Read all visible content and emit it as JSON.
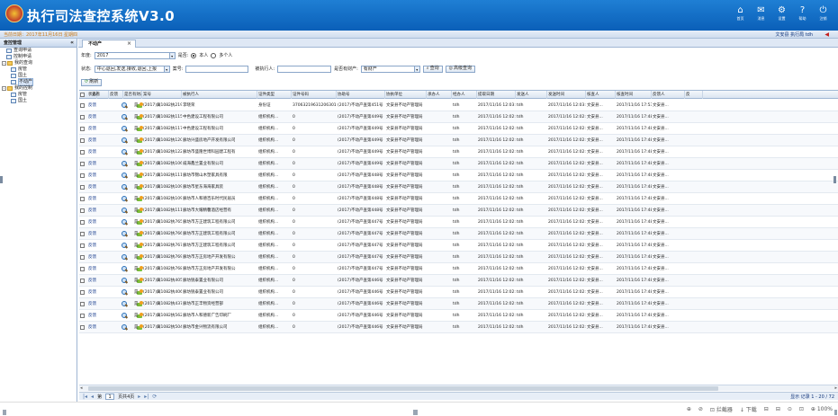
{
  "header": {
    "title": "执行司法查控系统V3.0",
    "toolbar": [
      {
        "icon": "home-icon",
        "glyph": "⌂",
        "label": "首页"
      },
      {
        "icon": "mail-icon",
        "glyph": "✉",
        "label": "消息"
      },
      {
        "icon": "gear-icon",
        "glyph": "⚙",
        "label": "设置"
      },
      {
        "icon": "help-icon",
        "glyph": "?",
        "label": "帮助"
      },
      {
        "icon": "power-icon",
        "glyph": "⏻",
        "label": "注销"
      }
    ]
  },
  "statusbar": {
    "date": "当前日期：2017年11月16日  星期四",
    "user": "文安县 执行局  tdh"
  },
  "sidebar": {
    "title": "查控管理",
    "items": [
      {
        "label": "查询申请",
        "level": 1,
        "type": "page"
      },
      {
        "label": "控制申请",
        "level": 1,
        "type": "page"
      },
      {
        "label": "我的查询",
        "level": 0,
        "type": "folder",
        "expander": "-"
      },
      {
        "label": "房管",
        "level": 2,
        "type": "page"
      },
      {
        "label": "国土",
        "level": 2,
        "type": "page"
      },
      {
        "label": "不动产",
        "level": 2,
        "type": "page",
        "selected": true
      },
      {
        "label": "我的控制",
        "level": 0,
        "type": "folder",
        "expander": "-"
      },
      {
        "label": "房管",
        "level": 2,
        "type": "page"
      },
      {
        "label": "国土",
        "level": 2,
        "type": "page"
      }
    ]
  },
  "tab": {
    "label": "不动产",
    "close": "×"
  },
  "filters": {
    "year_label": "年度:",
    "year_value": "2017",
    "is_self_label": "是否:",
    "radio_self": "本人",
    "radio_multi": "多个人",
    "status_label": "状态:",
    "status_value": "中心退回,发送,接收,退回,上报",
    "case_no_label": "案号:",
    "executed_label": "被执行人:",
    "has_property_label": "是否有财产:",
    "has_property_value": "有财产",
    "search_btn": "查询",
    "advanced_btn": "高级查询",
    "refresh_btn": "刷新"
  },
  "table": {
    "columns": [
      "状态",
      "查看",
      "反馈",
      "是否有财产",
      "案号",
      "被执行人",
      "证件类型",
      "证件号码",
      "协助号",
      "协执单位",
      "承办人",
      "经办人",
      "提取日期",
      "发送人",
      "发送时间",
      "核查人",
      "核查时间",
      "反馈人",
      "反"
    ],
    "rows": [
      {
        "status": "反馈",
        "has": "是",
        "case": "(2017)冀1082执2193号",
        "person": "李晓荣",
        "idtype": "身份证",
        "idno": "370632196312063019",
        "assist": "(2017)不动产查第451号",
        "unit": "文安县不动产管理局",
        "handler": "tdh",
        "extract": "2017/11/16 12:03:04",
        "sender": "tdh",
        "send_time": "2017/11/16 12:03:11",
        "checker": "文安县...",
        "check_time": "2017/11/16 17:53:41",
        "feedback": "文安县..."
      },
      {
        "status": "反馈",
        "has": "是",
        "case": "(2017)冀1082执1157号",
        "person": "中色建设工程有限公司",
        "idtype": "组织机构...",
        "idno": "0",
        "assist": "(2017)不动产查第449号",
        "unit": "文安县不动产管理局",
        "handler": "tdh",
        "extract": "2017/11/16 12:02:46",
        "sender": "tdh",
        "send_time": "2017/11/16 12:02:54",
        "checker": "文安县...",
        "check_time": "2017/11/16 17:48:07",
        "feedback": "文安县..."
      },
      {
        "status": "反馈",
        "has": "是",
        "case": "(2017)冀1082执1177号",
        "person": "中色建设工程有限公司",
        "idtype": "组织机构...",
        "idno": "0",
        "assist": "(2017)不动产查第449号",
        "unit": "文安县不动产管理局",
        "handler": "tdh",
        "extract": "2017/11/16 12:02:46",
        "sender": "tdh",
        "send_time": "2017/11/16 12:02:54",
        "checker": "文安县...",
        "check_time": "2017/11/16 17:48:07",
        "feedback": "文安县..."
      },
      {
        "status": "反馈",
        "has": "是",
        "case": "(2017)冀1082执1204号",
        "person": "廊坊兴盛房地产开发有限公司",
        "idtype": "组织机构...",
        "idno": "0",
        "assist": "(2017)不动产查第449号",
        "unit": "文安县不动产管理局",
        "handler": "tdh",
        "extract": "2017/11/16 12:02:46",
        "sender": "tdh",
        "send_time": "2017/11/16 12:02:54",
        "checker": "文安县...",
        "check_time": "2017/11/16 17:48:07",
        "feedback": "文安县..."
      },
      {
        "status": "反馈",
        "has": "是",
        "case": "(2017)冀1082执1221号",
        "person": "廊坊市盛隆世博科园建工程有",
        "idtype": "组织机构...",
        "idno": "0",
        "assist": "(2017)不动产查第449号",
        "unit": "文安县不动产管理局",
        "handler": "tdh",
        "extract": "2017/11/16 12:02:46",
        "sender": "tdh",
        "send_time": "2017/11/16 12:02:54",
        "checker": "文安县...",
        "check_time": "2017/11/16 17:48:07",
        "feedback": "文安县..."
      },
      {
        "status": "反馈",
        "has": "是",
        "case": "(2017)冀1082执1063号",
        "person": "威海鑫兰置业有限公司",
        "idtype": "组织机构...",
        "idno": "0",
        "assist": "(2017)不动产查第449号",
        "unit": "文安县不动产管理局",
        "handler": "tdh",
        "extract": "2017/11/16 12:02:46",
        "sender": "tdh",
        "send_time": "2017/11/16 12:02:54",
        "checker": "文安县...",
        "check_time": "2017/11/16 17:48:07",
        "feedback": "文安县..."
      },
      {
        "status": "反馈",
        "has": "是",
        "case": "(2017)冀1082执1117号",
        "person": "廊坊市锦山木塑家具有限",
        "idtype": "组织机构...",
        "idno": "0",
        "assist": "(2017)不动产查第448号",
        "unit": "文安县不动产管理局",
        "handler": "tdh",
        "extract": "2017/11/16 12:02:34",
        "sender": "tdh",
        "send_time": "2017/11/16 12:02:45",
        "checker": "文安县...",
        "check_time": "2017/11/16 17:48:07",
        "feedback": "文安县..."
      },
      {
        "status": "反馈",
        "has": "是",
        "case": "(2017)冀1082执1094号",
        "person": "廊坊市星东海海家具装",
        "idtype": "组织机构...",
        "idno": "0",
        "assist": "(2017)不动产查第448号",
        "unit": "文安县不动产管理局",
        "handler": "tdh",
        "extract": "2017/11/16 12:02:34",
        "sender": "tdh",
        "send_time": "2017/11/16 12:02:45",
        "checker": "文安县...",
        "check_time": "2017/11/16 17:48:07",
        "feedback": "文安县..."
      },
      {
        "status": "反馈",
        "has": "是",
        "case": "(2017)冀1082执1090号",
        "person": "廊坊市人和德百乐时代民居员",
        "idtype": "组织机构...",
        "idno": "0",
        "assist": "(2017)不动产查第448号",
        "unit": "文安县不动产管理局",
        "handler": "tdh",
        "extract": "2017/11/16 12:02:34",
        "sender": "tdh",
        "send_time": "2017/11/16 12:02:45",
        "checker": "文安县...",
        "check_time": "2017/11/16 17:48:07",
        "feedback": "文安县..."
      },
      {
        "status": "反馈",
        "has": "是",
        "case": "(2017)冀1082执1111号",
        "person": "廊坊市大耀精馨酒店经营有",
        "idtype": "组织机构...",
        "idno": "0",
        "assist": "(2017)不动产查第448号",
        "unit": "文安县不动产管理局",
        "handler": "tdh",
        "extract": "2017/11/16 12:02:34",
        "sender": "tdh",
        "send_time": "2017/11/16 12:02:45",
        "checker": "文安县...",
        "check_time": "2017/11/16 17:48:07",
        "feedback": "文安县..."
      },
      {
        "status": "反馈",
        "has": "是",
        "case": "(2017)冀1082执765号",
        "person": "廊坊市方正建筑工程有限公司",
        "idtype": "组织机构...",
        "idno": "0",
        "assist": "(2017)不动产查第447号",
        "unit": "文安县不动产管理局",
        "handler": "tdh",
        "extract": "2017/11/16 12:02:23",
        "sender": "tdh",
        "send_time": "2017/11/16 12:02:33",
        "checker": "文安县...",
        "check_time": "2017/11/16 17:48:07",
        "feedback": "文安县..."
      },
      {
        "status": "反馈",
        "has": "是",
        "case": "(2017)冀1082执766号",
        "person": "廊坊市方正建筑工程有限公司",
        "idtype": "组织机构...",
        "idno": "0",
        "assist": "(2017)不动产查第447号",
        "unit": "文安县不动产管理局",
        "handler": "tdh",
        "extract": "2017/11/16 12:02:23",
        "sender": "tdh",
        "send_time": "2017/11/16 12:02:33",
        "checker": "文安县...",
        "check_time": "2017/11/16 17:48:07",
        "feedback": "文安县..."
      },
      {
        "status": "反馈",
        "has": "是",
        "case": "(2017)冀1082执767号",
        "person": "廊坊市方正建筑工程有限公司",
        "idtype": "组织机构...",
        "idno": "0",
        "assist": "(2017)不动产查第447号",
        "unit": "文安县不动产管理局",
        "handler": "tdh",
        "extract": "2017/11/16 12:02:23",
        "sender": "tdh",
        "send_time": "2017/11/16 12:02:33",
        "checker": "文安县...",
        "check_time": "2017/11/16 17:48:07",
        "feedback": "文安县..."
      },
      {
        "status": "反馈",
        "has": "是",
        "case": "(2017)冀1082执769号",
        "person": "廊坊市方正房地产开发有限公",
        "idtype": "组织机构...",
        "idno": "0",
        "assist": "(2017)不动产查第447号",
        "unit": "文安县不动产管理局",
        "handler": "tdh",
        "extract": "2017/11/16 12:02:23",
        "sender": "tdh",
        "send_time": "2017/11/16 12:02:33",
        "checker": "文安县...",
        "check_time": "2017/11/16 17:48:07",
        "feedback": "文安县..."
      },
      {
        "status": "反馈",
        "has": "是",
        "case": "(2017)冀1082执768号",
        "person": "廊坊市方正房地产开发有限公",
        "idtype": "组织机构...",
        "idno": "0",
        "assist": "(2017)不动产查第447号",
        "unit": "文安县不动产管理局",
        "handler": "tdh",
        "extract": "2017/11/16 12:02:23",
        "sender": "tdh",
        "send_time": "2017/11/16 12:02:33",
        "checker": "文安县...",
        "check_time": "2017/11/16 17:48:07",
        "feedback": "文安县..."
      },
      {
        "status": "反馈",
        "has": "是",
        "case": "(2017)冀1082执405号",
        "person": "廊坊锐泰置业有限公司",
        "idtype": "组织机构...",
        "idno": "0",
        "assist": "(2017)不动产查第446号",
        "unit": "文安县不动产管理局",
        "handler": "tdh",
        "extract": "2017/11/16 12:02:15",
        "sender": "tdh",
        "send_time": "2017/11/16 12:02:22",
        "checker": "文安县...",
        "check_time": "2017/11/16 17:48:07",
        "feedback": "文安县..."
      },
      {
        "status": "反馈",
        "has": "是",
        "case": "(2017)冀1082执406号",
        "person": "廊坊锐泰置业有限公司",
        "idtype": "组织机构...",
        "idno": "0",
        "assist": "(2017)不动产查第446号",
        "unit": "文安县不动产管理局",
        "handler": "tdh",
        "extract": "2017/11/16 12:02:15",
        "sender": "tdh",
        "send_time": "2017/11/16 12:02:22",
        "checker": "文安县...",
        "check_time": "2017/11/16 17:48:07",
        "feedback": "文安县..."
      },
      {
        "status": "反馈",
        "has": "是",
        "case": "(2017)冀1082执437号",
        "person": "廊坊市正丰物资经营部",
        "idtype": "组织机构...",
        "idno": "0",
        "assist": "(2017)不动产查第446号",
        "unit": "文安县不动产管理局",
        "handler": "tdh",
        "extract": "2017/11/16 12:02:15",
        "sender": "tdh",
        "send_time": "2017/11/16 12:02:22",
        "checker": "文安县...",
        "check_time": "2017/11/16 17:48:07",
        "feedback": "文安县..."
      },
      {
        "status": "反馈",
        "has": "是",
        "case": "(2017)冀1082执562号",
        "person": "廊坊市人和德新广告印刷厂",
        "idtype": "组织机构...",
        "idno": "0",
        "assist": "(2017)不动产查第446号",
        "unit": "文安县不动产管理局",
        "handler": "tdh",
        "extract": "2017/11/16 12:02:15",
        "sender": "tdh",
        "send_time": "2017/11/16 12:02:22",
        "checker": "文安县...",
        "check_time": "2017/11/16 17:48:07",
        "feedback": "文安县..."
      },
      {
        "status": "反馈",
        "has": "是",
        "case": "(2017)冀1082执504号",
        "person": "廊坊市金兴物流有限公司",
        "idtype": "组织机构...",
        "idno": "0",
        "assist": "(2017)不动产查第446号",
        "unit": "文安县不动产管理局",
        "handler": "tdh",
        "extract": "2017/11/16 12:02:15",
        "sender": "tdh",
        "send_time": "2017/11/16 12:02:22",
        "checker": "文安县...",
        "check_time": "2017/11/16 17:48:07",
        "feedback": "文安县..."
      }
    ]
  },
  "pager": {
    "first": "|◂",
    "prev": "◂",
    "page_label": "第",
    "page_value": "1",
    "total": "页共4页",
    "next": "▸",
    "last": "▸|",
    "refresh": "⟳",
    "record_count": "显示 记录 1 - 20 / 72"
  },
  "browser_status": {
    "items": [
      "⊕",
      "⊘",
      "⊡ 拦截器",
      "↓ 下载",
      "⊟",
      "⊟",
      "⊙",
      "⊡",
      "⊕ 100%"
    ]
  },
  "colors": {
    "header": "#0a5fb8",
    "accent": "#1a3f8f",
    "status_date": "#c87a1a"
  }
}
